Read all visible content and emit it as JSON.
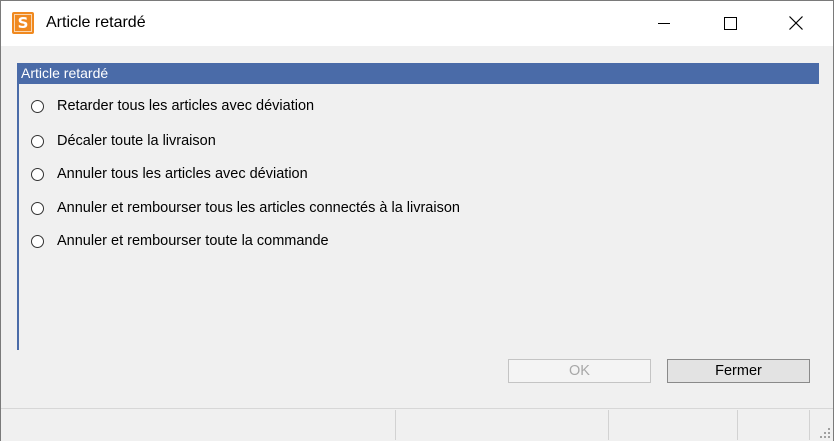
{
  "window": {
    "title": "Article retardé",
    "app_icon_letter": "S",
    "app_icon_color": "#f0891f"
  },
  "group": {
    "header": "Article retardé",
    "accent_color": "#4a6ba8",
    "options": [
      {
        "label": "Retarder tous les articles avec déviation",
        "selected": false
      },
      {
        "label": "Décaler toute la livraison",
        "selected": false
      },
      {
        "label": "Annuler tous les articles avec déviation",
        "selected": false
      },
      {
        "label": "Annuler et rembourser tous les articles connectés à la livraison",
        "selected": false
      },
      {
        "label": "Annuler et rembourser toute la commande",
        "selected": false
      }
    ]
  },
  "buttons": {
    "ok_label": "OK",
    "ok_enabled": false,
    "close_label": "Fermer"
  }
}
